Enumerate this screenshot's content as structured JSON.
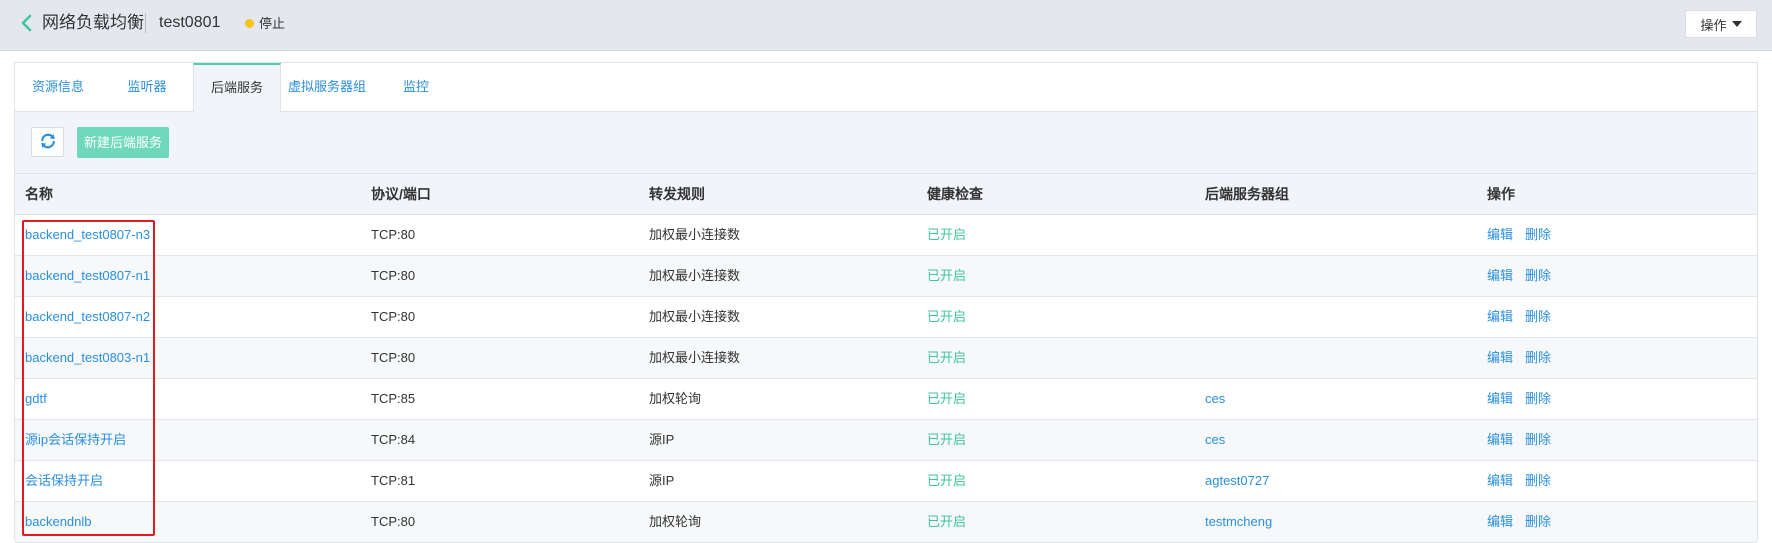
{
  "header": {
    "title": "网络负载均衡",
    "instance_name": "test0801",
    "status": "停止",
    "ops_label": "操作",
    "status_color": "#f5c518"
  },
  "tabs": [
    {
      "label": "资源信息",
      "active": false
    },
    {
      "label": "监听器",
      "active": false
    },
    {
      "label": "后端服务",
      "active": true
    },
    {
      "label": "虚拟服务器组",
      "active": false
    },
    {
      "label": "监控",
      "active": false
    }
  ],
  "toolbar": {
    "refresh_icon": "refresh-icon",
    "new_label": "新建后端服务"
  },
  "table": {
    "columns": [
      "名称",
      "协议/端口",
      "转发规则",
      "健康检查",
      "后端服务器组",
      "操作"
    ],
    "rows": [
      {
        "name": "backend_test0807-n3",
        "protocol": "TCP:80",
        "rule": "加权最小连接数",
        "health": "已开启",
        "group": "",
        "edit": "编辑",
        "delete": "删除"
      },
      {
        "name": "backend_test0807-n1",
        "protocol": "TCP:80",
        "rule": "加权最小连接数",
        "health": "已开启",
        "group": "",
        "edit": "编辑",
        "delete": "删除"
      },
      {
        "name": "backend_test0807-n2",
        "protocol": "TCP:80",
        "rule": "加权最小连接数",
        "health": "已开启",
        "group": "",
        "edit": "编辑",
        "delete": "删除"
      },
      {
        "name": "backend_test0803-n1",
        "protocol": "TCP:80",
        "rule": "加权最小连接数",
        "health": "已开启",
        "group": "",
        "edit": "编辑",
        "delete": "删除"
      },
      {
        "name": "gdtf",
        "protocol": "TCP:85",
        "rule": "加权轮询",
        "health": "已开启",
        "group": "ces",
        "edit": "编辑",
        "delete": "删除"
      },
      {
        "name": "源ip会话保持开启",
        "protocol": "TCP:84",
        "rule": "源IP",
        "health": "已开启",
        "group": "ces",
        "edit": "编辑",
        "delete": "删除"
      },
      {
        "name": "会话保持开启",
        "protocol": "TCP:81",
        "rule": "源IP",
        "health": "已开启",
        "group": "agtest0727",
        "edit": "编辑",
        "delete": "删除"
      },
      {
        "name": "backendnlb",
        "protocol": "TCP:80",
        "rule": "加权轮询",
        "health": "已开启",
        "group": "testmcheng",
        "edit": "编辑",
        "delete": "删除"
      }
    ]
  },
  "colors": {
    "accent": "#4fcea8",
    "link": "#2a8fe0",
    "health_on": "#3fc59b",
    "highlight": "#e01b24"
  }
}
